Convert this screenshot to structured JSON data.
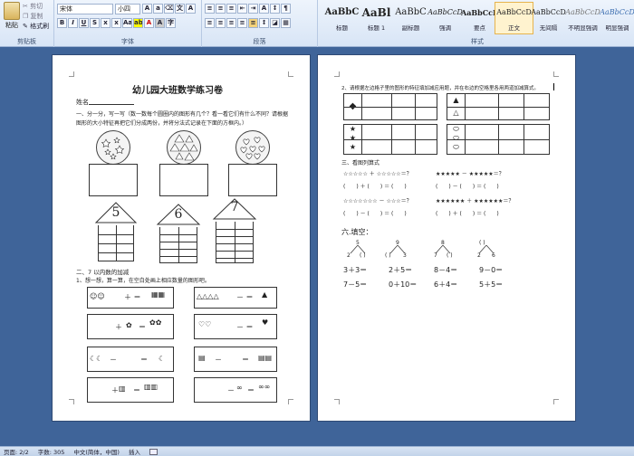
{
  "ribbon": {
    "clipboard": {
      "paste": "粘贴",
      "cut": "剪切",
      "copy": "复制",
      "format_painter": "格式刷",
      "label": "剪贴板"
    },
    "font": {
      "name": "宋体",
      "size": "小四",
      "label": "字体"
    },
    "paragraph": {
      "label": "段落"
    },
    "styles": {
      "label": "样式",
      "items": [
        {
          "sample": "AaBbC",
          "name": "标题"
        },
        {
          "sample": "AaBl",
          "name": "标题 1"
        },
        {
          "sample": "AaBbC",
          "name": "副标题"
        },
        {
          "sample": "AaBbCcD",
          "name": "强调"
        },
        {
          "sample": "AaBbCcD",
          "name": "要点"
        },
        {
          "sample": "AaBbCcD",
          "name": "正文"
        },
        {
          "sample": "AaBbCcD",
          "name": "无间隔"
        },
        {
          "sample": "AaBbCcD",
          "name": "不明显强调"
        },
        {
          "sample": "AaBbCcD",
          "name": "明显强调"
        }
      ]
    }
  },
  "page1": {
    "title": "幼儿园大班数学练习卷",
    "name_label": "姓名",
    "q1": "一、分一分，写一写（数一数每个圆圈内的图形有几个？看一看它们有什么不同？请根据",
    "q1b": "图形的大小特征再把它们分成两份，并将分法式记录在下面的方框内。）",
    "house_digits": [
      "5",
      "6",
      "7"
    ],
    "q2": "二、7 以内数的加减",
    "q2_sub": "1、想一想，算一算，在空白处画上相应数量的图形吧。"
  },
  "page2": {
    "q2_2": "2、请根据左边格子里的图形的特征填加减应用题，并在右边的空格里各用两道加减算式。",
    "q3": "三、看图列算式",
    "q6": "六.填空：",
    "decompose": [
      {
        "top": "5",
        "left": "2",
        "right": "( )"
      },
      {
        "top": "9",
        "left": "( )",
        "right": "3"
      },
      {
        "top": "8",
        "left": "7",
        "right": "( )"
      },
      {
        "top": "( )",
        "left": "2",
        "right": "6"
      }
    ],
    "eqs_row1": [
      "3＋3＝",
      "2＋5＝",
      "8－4＝",
      "9－0＝"
    ],
    "eqs_row2": [
      "7－5＝",
      "0＋10＝",
      "6＋4＝",
      "5＋5＝"
    ]
  },
  "status": {
    "page": "页面: 2/2",
    "words": "字数: 305",
    "lang": "中文(简体，中国)",
    "mode": "插入"
  }
}
